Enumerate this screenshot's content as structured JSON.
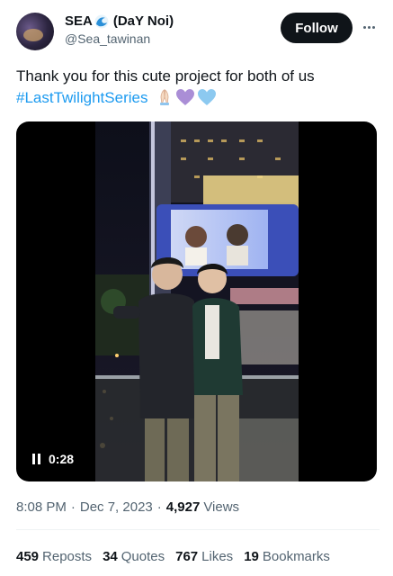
{
  "author": {
    "display_name": "SEA",
    "display_name_suffix": "(DaY Noi)",
    "handle": "@Sea_tawinan"
  },
  "actions": {
    "follow_label": "Follow"
  },
  "tweet": {
    "text_line1": "Thank you for this cute project for both of us",
    "hashtag": "#LastTwilightSeries"
  },
  "media": {
    "duration": "0:28"
  },
  "meta": {
    "time": "8:08 PM",
    "date": "Dec 7, 2023",
    "views_count": "4,927",
    "views_label": "Views"
  },
  "stats": [
    {
      "count": "459",
      "label": "Reposts"
    },
    {
      "count": "34",
      "label": "Quotes"
    },
    {
      "count": "767",
      "label": "Likes"
    },
    {
      "count": "19",
      "label": "Bookmarks"
    }
  ],
  "colors": {
    "accent": "#1d9bf0",
    "text_primary": "#0f1419",
    "text_secondary": "#536471",
    "follow_bg": "#0f1419"
  },
  "icons": [
    "wave-icon",
    "more-icon",
    "folded-hands-icon",
    "purple-heart-icon",
    "light-blue-heart-icon",
    "pause-icon"
  ]
}
